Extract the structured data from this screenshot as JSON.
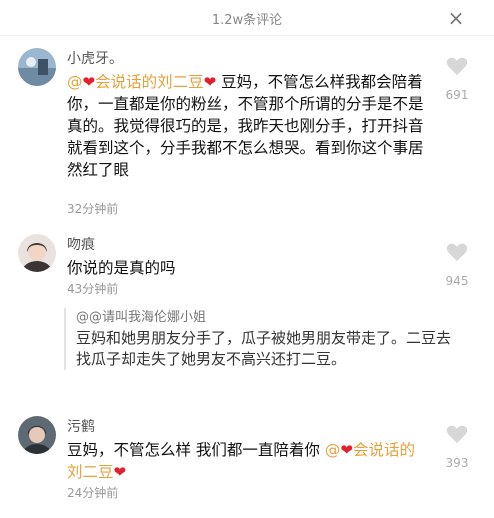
{
  "header": {
    "title": "1.2w条评论",
    "close_label": "×"
  },
  "comments": [
    {
      "username": "小虎牙。",
      "mention": "@",
      "mention_name": "会说话的刘二豆",
      "body": "豆妈，不管怎么样我都会陪着你，一直都是你的粉丝，不管那个所谓的分手是不是真的。我觉得很巧的是，我昨天也刚分手，打开抖音就看到这个，分手我都不怎么想哭。看到你这个事居然红了眼",
      "time": "32分钟前",
      "likes": "691"
    },
    {
      "username": "吻痕",
      "body": "你说的是真的吗",
      "time": "43分钟前",
      "likes": "945",
      "reply": {
        "author": "@@请叫我海伦娜小姐",
        "text": "豆妈和她男朋友分手了，瓜子被她男朋友带走了。二豆去找瓜子却走失了她男友不高兴还打二豆。"
      }
    },
    {
      "username": "污鹤",
      "body": "豆妈，不管怎么样  我们都一直陪着你  ",
      "mention": "@",
      "mention_name": "会说话的刘二豆",
      "time": "24分钟前",
      "likes": "393"
    }
  ],
  "colors": {
    "mention": "#e6a23c",
    "heart": "#e0202a",
    "muted": "#999999"
  },
  "icons": {
    "like": "heart-outline-icon",
    "close": "close-icon",
    "inline_heart": "red-heart-icon"
  }
}
